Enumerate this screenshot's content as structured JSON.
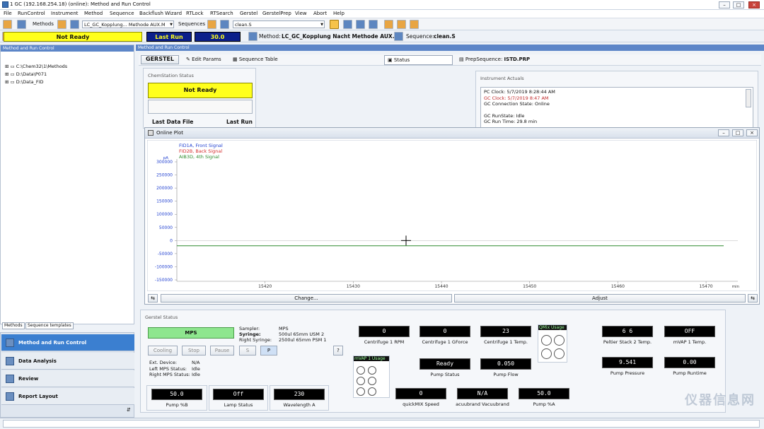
{
  "window": {
    "title": "1 GC (192.168.254.18) (online): Method and Run Control"
  },
  "menu": [
    "File",
    "RunControl",
    "Instrument",
    "Method",
    "Sequence",
    "Backflush Wizard",
    "RTLock",
    "RTSearch",
    "Gerstel",
    "GerstelPrep",
    "View",
    "Abort",
    "Help"
  ],
  "toolbar": {
    "methods_label": "Methods",
    "method_value": "LC_GC_Kopplung... Methode AUX.M",
    "sequences_label": "Sequences",
    "sequence_value": "clean.S"
  },
  "statusrow": {
    "not_ready": "Not Ready",
    "last_run": "Last Run",
    "run_value": "30.0",
    "method_label": "Method:",
    "method_name": "LC_GC_Kopplung Nacht Methode AUX.M",
    "sequence_label": "Sequence:",
    "sequence_name": "clean.S"
  },
  "left": {
    "title": "Method and Run Control",
    "tree": [
      "C:\\Chem32\\1\\Methods",
      "D:\\Data\\P071",
      "D:\\Data_FID"
    ],
    "tabs": [
      "Methods",
      "Sequence templates"
    ],
    "nav": [
      "Method and Run Control",
      "Data Analysis",
      "Review",
      "Report Layout"
    ]
  },
  "right": {
    "title": "Method and Run Control",
    "gerstel": "GERSTEL",
    "edit_params": "Edit Params",
    "sequence_table": "Sequence Table",
    "status": "Status",
    "prep_label": "PrepSequence:",
    "prep_value": "ISTD.PRP"
  },
  "chemstation": {
    "title": "ChemStation Status",
    "status": "Not Ready",
    "last_data_file": "Last Data File",
    "last_run": "Last Run"
  },
  "actuals": {
    "title": "Instrument Actuals",
    "lines": [
      "PC Clock: 5/7/2019 8:28:44 AM",
      "GC Clock: 5/7/2019 8:47 AM",
      "GC Connection State:  Online",
      "",
      "GC RunState:  Idle",
      "GC Run Time:  29.8 min"
    ]
  },
  "plot": {
    "title": "Online Plot",
    "legend": [
      "FID1A, Front Signal",
      "FID2B, Back Signal",
      "AIB3D, 4th Signal"
    ],
    "yunit": "pA",
    "xunit": "min",
    "change": "Change...",
    "adjust": "Adjust"
  },
  "chart_data": {
    "type": "line",
    "title": "",
    "xlabel": "min",
    "ylabel": "pA",
    "xlim": [
      15410,
      15472
    ],
    "ylim": [
      -150000,
      300000
    ],
    "xticks": [
      15420,
      15430,
      15440,
      15450,
      15460,
      15470
    ],
    "yticks": [
      300000,
      250000,
      200000,
      150000,
      100000,
      50000,
      0,
      -50000,
      -100000,
      -150000
    ],
    "series": [
      {
        "name": "AIB3D, 4th Signal",
        "color": "#2e8b2e",
        "x": [
          15410,
          15472
        ],
        "values": [
          -20000,
          -20000
        ]
      }
    ],
    "legend_colors": [
      "#1f3fd0",
      "#d42b2b",
      "#2e8b2e"
    ]
  },
  "gerstel": {
    "title": "Gerstel Status",
    "mps": "MPS",
    "sampler_label": "Sampler:",
    "sampler": "MPS",
    "syringe_label": "Syringe:",
    "syringe": "500ul 65mm USM 2",
    "rsyringe_label": "Right Syringe:",
    "rsyringe": "2500ul 65mm PSM 1",
    "ext_label": "Ext. Device:",
    "ext": "N/A",
    "left_label": "Left MPS Status:",
    "left": "Idle",
    "right_label": "Right MPS Status:",
    "right": "Idle",
    "buttons": [
      "Cooling",
      "Stop",
      "Pause",
      "S",
      "P"
    ],
    "gauges": [
      {
        "value": "50.0",
        "label": "Pump %B"
      },
      {
        "value": "Off",
        "label": "Lamp Status"
      },
      {
        "value": "230",
        "label": "Wavelength A"
      },
      {
        "value": "0",
        "label": "Centrifuge 1 RPM"
      },
      {
        "value": "0",
        "label": "Centrifuge 1 GForce"
      },
      {
        "value": "23",
        "label": "Centrifuge 1 Temp."
      },
      {
        "value": "Ready",
        "label": "Pump Status"
      },
      {
        "value": "0.050",
        "label": "Pump Flow"
      },
      {
        "value": "0",
        "label": "quickMIX Speed"
      },
      {
        "value": "N/A",
        "label": "acuubrand Vacuubrand"
      },
      {
        "value": "50.0",
        "label": "Pump %A"
      },
      {
        "value": "6        6",
        "label": "Peltier Stack 2 Temp."
      },
      {
        "value": "OFF",
        "label": "mVAP 1 Temp."
      },
      {
        "value": "9.541",
        "label": "Pump Pressure"
      },
      {
        "value": "0.00",
        "label": "Pump Runtime"
      }
    ],
    "mvap_usage": "mVAP 1 Usage",
    "qmix_usage": "QMix Usage"
  },
  "watermark": "仪器信息网"
}
